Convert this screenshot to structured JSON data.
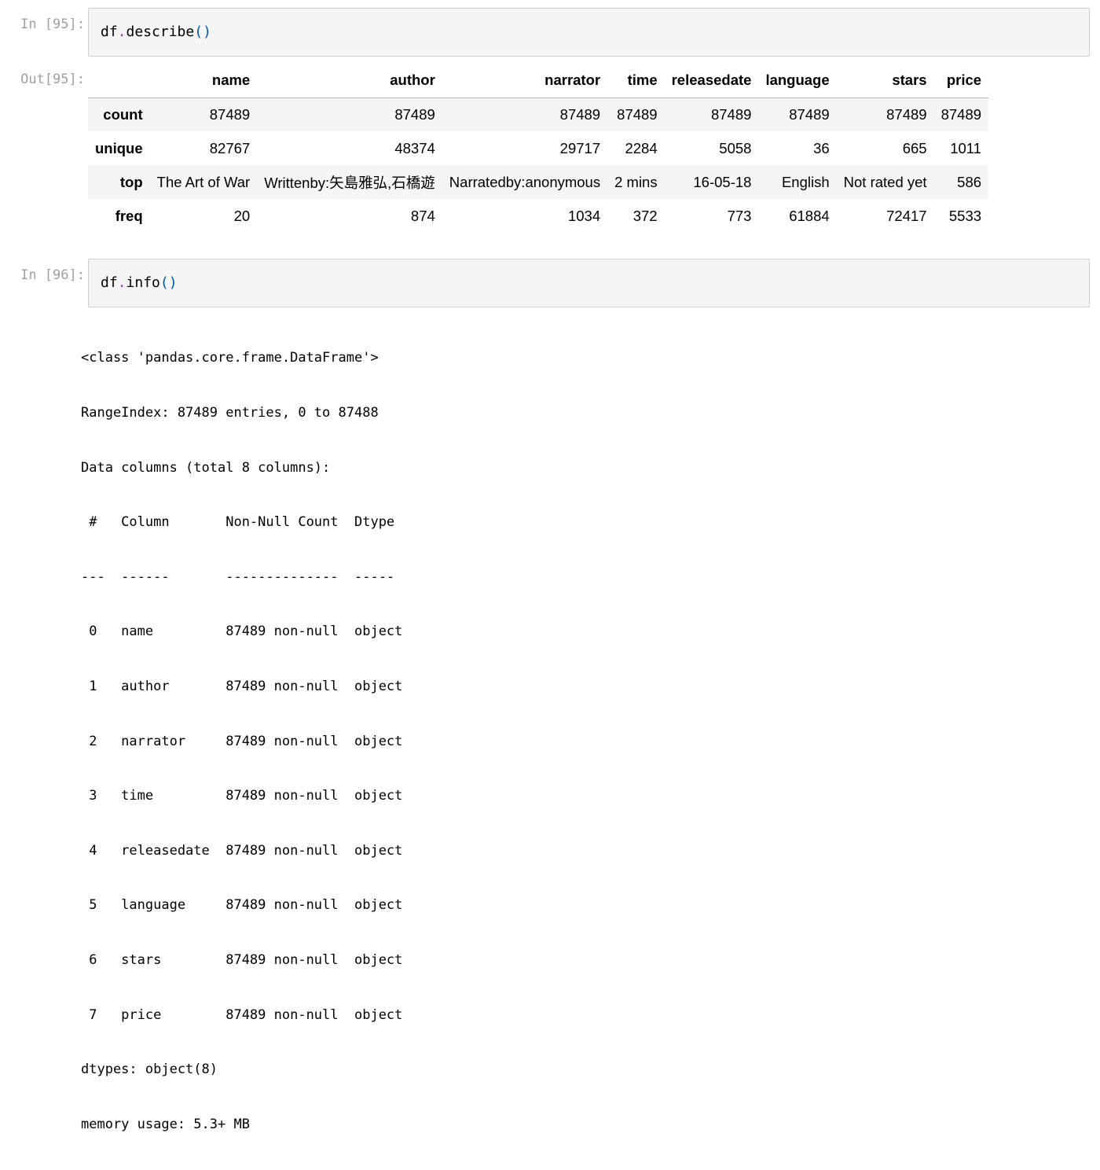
{
  "cells": [
    {
      "in_prompt": "In [95]:",
      "code_obj": "df",
      "code_dot": ".",
      "code_method": "describe",
      "code_parens": "()",
      "out_prompt": "Out[95]:",
      "table": {
        "columns": [
          "name",
          "author",
          "narrator",
          "time",
          "releasedate",
          "language",
          "stars",
          "price"
        ],
        "rows": [
          {
            "label": "count",
            "values": [
              "87489",
              "87489",
              "87489",
              "87489",
              "87489",
              "87489",
              "87489",
              "87489"
            ]
          },
          {
            "label": "unique",
            "values": [
              "82767",
              "48374",
              "29717",
              "2284",
              "5058",
              "36",
              "665",
              "1011"
            ]
          },
          {
            "label": "top",
            "values": [
              "The Art of War",
              "Writtenby:矢島雅弘,石橋遊",
              "Narratedby:anonymous",
              "2 mins",
              "16-05-18",
              "English",
              "Not rated yet",
              "586"
            ]
          },
          {
            "label": "freq",
            "values": [
              "20",
              "874",
              "1034",
              "372",
              "773",
              "61884",
              "72417",
              "5533"
            ]
          }
        ]
      }
    },
    {
      "in_prompt": "In [96]:",
      "code_obj": "df",
      "code_dot": ".",
      "code_method": "info",
      "code_parens": "()",
      "output_lines": [
        "<class 'pandas.core.frame.DataFrame'>",
        "RangeIndex: 87489 entries, 0 to 87488",
        "Data columns (total 8 columns):",
        " #   Column       Non-Null Count  Dtype ",
        "---  ------       --------------  ----- ",
        " 0   name         87489 non-null  object",
        " 1   author       87489 non-null  object",
        " 2   narrator     87489 non-null  object",
        " 3   time         87489 non-null  object",
        " 4   releasedate  87489 non-null  object",
        " 5   language     87489 non-null  object",
        " 6   stars        87489 non-null  object",
        " 7   price        87489 non-null  object",
        "dtypes: object(8)",
        "memory usage: 5.3+ MB"
      ]
    }
  ],
  "colors": {
    "prompt": "#a0a0a0",
    "input_bg": "#f5f5f5",
    "input_border": "#cfcfcf",
    "operator": "#aa22ff",
    "paren": "#0055aa"
  }
}
